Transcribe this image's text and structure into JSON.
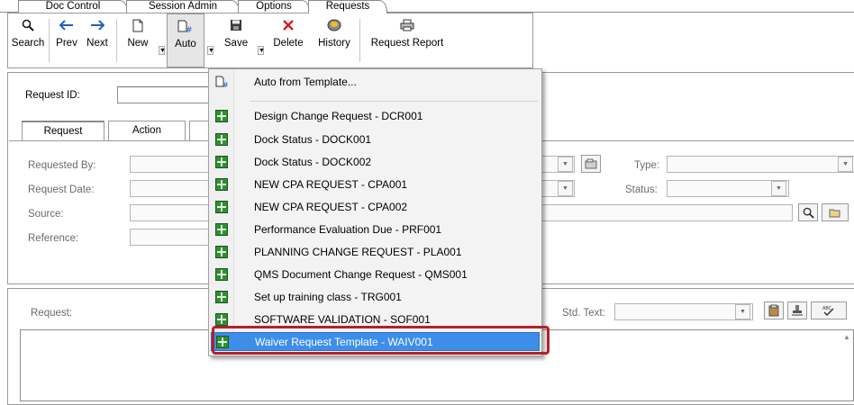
{
  "tabs": [
    {
      "label": "Doc Control"
    },
    {
      "label": "Session Admin"
    },
    {
      "label": "Options"
    },
    {
      "label": "Requests",
      "active": true
    }
  ],
  "toolbar": {
    "search": "Search",
    "prev": "Prev",
    "next": "Next",
    "new": "New",
    "auto": "Auto",
    "save": "Save",
    "delete": "Delete",
    "history": "History",
    "request_report": "Request Report"
  },
  "form": {
    "request_id_label": "Request ID:",
    "request_id_value": "",
    "inner_tabs": [
      {
        "label": "Request"
      },
      {
        "label": "Action"
      }
    ],
    "requested_by_label": "Requested By:",
    "request_date_label": "Request Date:",
    "source_label": "Source:",
    "reference_label": "Reference:",
    "type_label": "Type:",
    "status_label": "Status:",
    "request_label": "Request:",
    "std_text_label": "Std. Text:"
  },
  "auto_menu": {
    "auto_from_template": "Auto from Template...",
    "items": [
      {
        "label": "Design Change Request - DCR001"
      },
      {
        "label": "Dock Status - DOCK001"
      },
      {
        "label": "Dock Status - DOCK002"
      },
      {
        "label": "NEW CPA REQUEST - CPA001"
      },
      {
        "label": "NEW CPA REQUEST - CPA002"
      },
      {
        "label": "Performance Evaluation Due - PRF001"
      },
      {
        "label": "PLANNING CHANGE REQUEST - PLA001"
      },
      {
        "label": "QMS Document Change Request - QMS001"
      },
      {
        "label": "Set up training class - TRG001"
      },
      {
        "label": "SOFTWARE VALIDATION  - SOF001"
      },
      {
        "label": "Waiver Request Template - WAIV001",
        "selected": true
      }
    ]
  },
  "colors": {
    "selection": "#3d8ee8",
    "highlight_border": "#b5202a",
    "template_icon": "#2f8f32"
  }
}
